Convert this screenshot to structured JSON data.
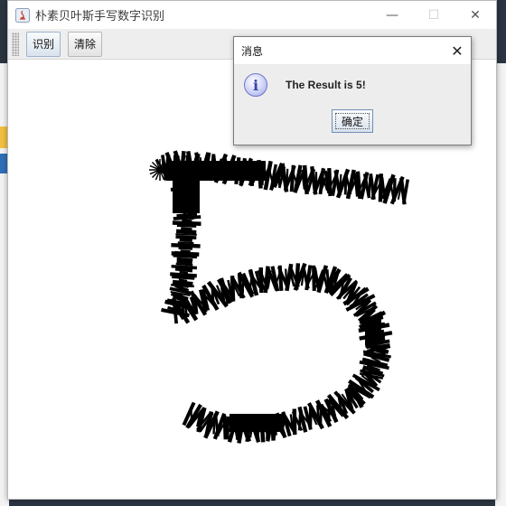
{
  "window": {
    "title": "朴素贝叶斯手写数字识别",
    "minimize_symbol": "—",
    "maximize_symbol": "☐",
    "close_symbol": "✕"
  },
  "toolbar": {
    "recognize_label": "识别",
    "clear_label": "清除"
  },
  "canvas": {
    "stroke_color": "#000000",
    "background_color": "#ffffff"
  },
  "dialog": {
    "title": "消息",
    "message": "The Result is 5!",
    "ok_label": "确定",
    "close_symbol": "✕",
    "icon": "info-icon",
    "icon_glyph": "i"
  }
}
